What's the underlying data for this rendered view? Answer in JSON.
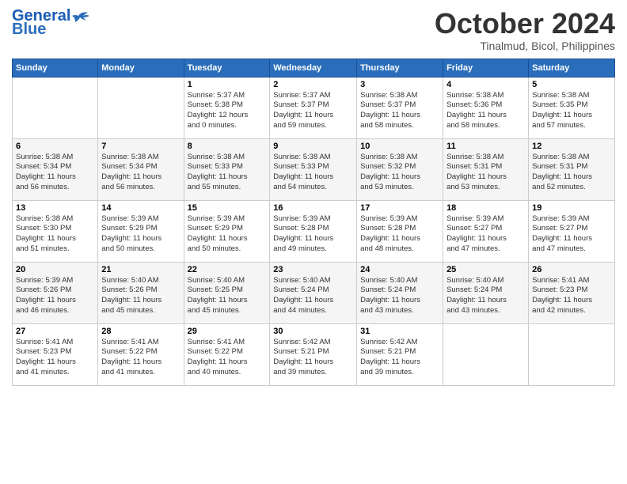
{
  "header": {
    "logo_line1": "General",
    "logo_line2": "Blue",
    "month": "October 2024",
    "location": "Tinalmud, Bicol, Philippines"
  },
  "days_of_week": [
    "Sunday",
    "Monday",
    "Tuesday",
    "Wednesday",
    "Thursday",
    "Friday",
    "Saturday"
  ],
  "weeks": [
    [
      {
        "day": "",
        "detail": ""
      },
      {
        "day": "",
        "detail": ""
      },
      {
        "day": "1",
        "detail": "Sunrise: 5:37 AM\nSunset: 5:38 PM\nDaylight: 12 hours\nand 0 minutes."
      },
      {
        "day": "2",
        "detail": "Sunrise: 5:37 AM\nSunset: 5:37 PM\nDaylight: 11 hours\nand 59 minutes."
      },
      {
        "day": "3",
        "detail": "Sunrise: 5:38 AM\nSunset: 5:37 PM\nDaylight: 11 hours\nand 58 minutes."
      },
      {
        "day": "4",
        "detail": "Sunrise: 5:38 AM\nSunset: 5:36 PM\nDaylight: 11 hours\nand 58 minutes."
      },
      {
        "day": "5",
        "detail": "Sunrise: 5:38 AM\nSunset: 5:35 PM\nDaylight: 11 hours\nand 57 minutes."
      }
    ],
    [
      {
        "day": "6",
        "detail": "Sunrise: 5:38 AM\nSunset: 5:34 PM\nDaylight: 11 hours\nand 56 minutes."
      },
      {
        "day": "7",
        "detail": "Sunrise: 5:38 AM\nSunset: 5:34 PM\nDaylight: 11 hours\nand 56 minutes."
      },
      {
        "day": "8",
        "detail": "Sunrise: 5:38 AM\nSunset: 5:33 PM\nDaylight: 11 hours\nand 55 minutes."
      },
      {
        "day": "9",
        "detail": "Sunrise: 5:38 AM\nSunset: 5:33 PM\nDaylight: 11 hours\nand 54 minutes."
      },
      {
        "day": "10",
        "detail": "Sunrise: 5:38 AM\nSunset: 5:32 PM\nDaylight: 11 hours\nand 53 minutes."
      },
      {
        "day": "11",
        "detail": "Sunrise: 5:38 AM\nSunset: 5:31 PM\nDaylight: 11 hours\nand 53 minutes."
      },
      {
        "day": "12",
        "detail": "Sunrise: 5:38 AM\nSunset: 5:31 PM\nDaylight: 11 hours\nand 52 minutes."
      }
    ],
    [
      {
        "day": "13",
        "detail": "Sunrise: 5:38 AM\nSunset: 5:30 PM\nDaylight: 11 hours\nand 51 minutes."
      },
      {
        "day": "14",
        "detail": "Sunrise: 5:39 AM\nSunset: 5:29 PM\nDaylight: 11 hours\nand 50 minutes."
      },
      {
        "day": "15",
        "detail": "Sunrise: 5:39 AM\nSunset: 5:29 PM\nDaylight: 11 hours\nand 50 minutes."
      },
      {
        "day": "16",
        "detail": "Sunrise: 5:39 AM\nSunset: 5:28 PM\nDaylight: 11 hours\nand 49 minutes."
      },
      {
        "day": "17",
        "detail": "Sunrise: 5:39 AM\nSunset: 5:28 PM\nDaylight: 11 hours\nand 48 minutes."
      },
      {
        "day": "18",
        "detail": "Sunrise: 5:39 AM\nSunset: 5:27 PM\nDaylight: 11 hours\nand 47 minutes."
      },
      {
        "day": "19",
        "detail": "Sunrise: 5:39 AM\nSunset: 5:27 PM\nDaylight: 11 hours\nand 47 minutes."
      }
    ],
    [
      {
        "day": "20",
        "detail": "Sunrise: 5:39 AM\nSunset: 5:26 PM\nDaylight: 11 hours\nand 46 minutes."
      },
      {
        "day": "21",
        "detail": "Sunrise: 5:40 AM\nSunset: 5:26 PM\nDaylight: 11 hours\nand 45 minutes."
      },
      {
        "day": "22",
        "detail": "Sunrise: 5:40 AM\nSunset: 5:25 PM\nDaylight: 11 hours\nand 45 minutes."
      },
      {
        "day": "23",
        "detail": "Sunrise: 5:40 AM\nSunset: 5:24 PM\nDaylight: 11 hours\nand 44 minutes."
      },
      {
        "day": "24",
        "detail": "Sunrise: 5:40 AM\nSunset: 5:24 PM\nDaylight: 11 hours\nand 43 minutes."
      },
      {
        "day": "25",
        "detail": "Sunrise: 5:40 AM\nSunset: 5:24 PM\nDaylight: 11 hours\nand 43 minutes."
      },
      {
        "day": "26",
        "detail": "Sunrise: 5:41 AM\nSunset: 5:23 PM\nDaylight: 11 hours\nand 42 minutes."
      }
    ],
    [
      {
        "day": "27",
        "detail": "Sunrise: 5:41 AM\nSunset: 5:23 PM\nDaylight: 11 hours\nand 41 minutes."
      },
      {
        "day": "28",
        "detail": "Sunrise: 5:41 AM\nSunset: 5:22 PM\nDaylight: 11 hours\nand 41 minutes."
      },
      {
        "day": "29",
        "detail": "Sunrise: 5:41 AM\nSunset: 5:22 PM\nDaylight: 11 hours\nand 40 minutes."
      },
      {
        "day": "30",
        "detail": "Sunrise: 5:42 AM\nSunset: 5:21 PM\nDaylight: 11 hours\nand 39 minutes."
      },
      {
        "day": "31",
        "detail": "Sunrise: 5:42 AM\nSunset: 5:21 PM\nDaylight: 11 hours\nand 39 minutes."
      },
      {
        "day": "",
        "detail": ""
      },
      {
        "day": "",
        "detail": ""
      }
    ]
  ]
}
